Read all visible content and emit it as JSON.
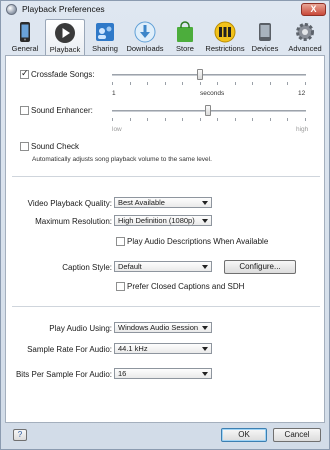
{
  "window": {
    "title": "Playback Preferences",
    "close_glyph": "X"
  },
  "toolbar": {
    "items": [
      {
        "label": "General",
        "icon": "iphone-icon"
      },
      {
        "label": "Playback",
        "icon": "play-icon"
      },
      {
        "label": "Sharing",
        "icon": "sharing-icon"
      },
      {
        "label": "Downloads",
        "icon": "downloads-icon"
      },
      {
        "label": "Store",
        "icon": "store-bag-icon"
      },
      {
        "label": "Restrictions",
        "icon": "restrictions-icon"
      },
      {
        "label": "Devices",
        "icon": "device-icon"
      },
      {
        "label": "Advanced",
        "icon": "gear-icon"
      }
    ],
    "active": "Playback"
  },
  "crossfade": {
    "label": "Crossfade Songs:",
    "checked": true,
    "min": "1",
    "unit": "seconds",
    "max": "12",
    "value": 6
  },
  "enhancer": {
    "label": "Sound Enhancer:",
    "checked": false,
    "low": "low",
    "high": "high",
    "level": 0.5
  },
  "soundcheck": {
    "label": "Sound Check",
    "checked": false,
    "description": "Automatically adjusts song playback volume to the same level."
  },
  "video": {
    "quality_label": "Video Playback Quality:",
    "quality_value": "Best Available",
    "resolution_label": "Maximum Resolution:",
    "resolution_value": "High Definition (1080p)",
    "audio_desc_label": "Play Audio Descriptions When Available"
  },
  "captions": {
    "style_label": "Caption Style:",
    "style_value": "Default",
    "configure_label": "Configure...",
    "prefer_label": "Prefer Closed Captions and SDH"
  },
  "audio": {
    "play_using_label": "Play Audio Using:",
    "play_using_value": "Windows Audio Session",
    "sample_rate_label": "Sample Rate For Audio:",
    "sample_rate_value": "44.1 kHz",
    "bits_label": "Bits Per Sample For Audio:",
    "bits_value": "16"
  },
  "footer": {
    "help_label": "?",
    "ok_label": "OK",
    "cancel_label": "Cancel"
  }
}
